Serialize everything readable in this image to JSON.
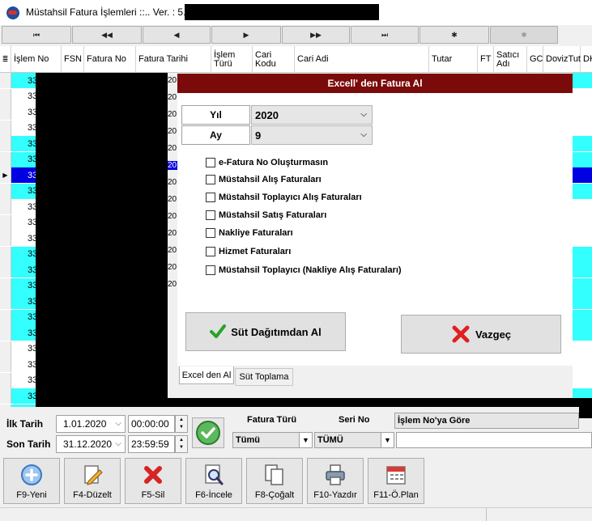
{
  "window": {
    "title": "Müstahsil Fatura İşlemleri ::.. Ver. : 5.0"
  },
  "nav": {
    "first": "⏮",
    "prev_page": "◀◀",
    "prev": "◀",
    "next": "▶",
    "next_page": "▶▶",
    "last": "⏭",
    "refresh": "✱",
    "cancel": "✱"
  },
  "grid": {
    "columns": [
      "İşlem No",
      "FSN",
      "Fatura No",
      "Fatura Tarihi",
      "İşlem Türü",
      "Cari Kodu",
      "Cari Adi",
      "Tutar",
      "FT",
      "Satıcı Adı",
      "GC",
      "DovizTut",
      "DK"
    ],
    "rows": [
      "33",
      "33",
      "33",
      "33",
      "33",
      "33",
      "33",
      "33",
      "33",
      "33",
      "33",
      "33",
      "33",
      "33",
      "33",
      "33",
      "33",
      "33",
      "33",
      "33",
      "33",
      "33"
    ],
    "fragments": [
      "20",
      "20",
      "20",
      "20",
      "20",
      "20",
      "20",
      "20",
      "20",
      "20",
      "20",
      "20",
      "20"
    ],
    "colors": {
      "cyan": "#33ffff",
      "selected": "#0000e0"
    }
  },
  "dialog": {
    "title": "Excell' den Fatura Al",
    "year_label": "Yıl",
    "year_value": "2020",
    "month_label": "Ay",
    "month_value": "9",
    "options": [
      "e-Fatura No Oluşturmasın",
      "Müstahsil Alış Faturaları",
      "Müstahsil Toplayıcı Alış Faturaları",
      "Müstahsil Satış Faturaları",
      "Nakliye Faturaları",
      "Hizmet Faturaları",
      "Müstahsil Toplayıcı (Nakliye Alış Faturaları)"
    ],
    "ok_button": "Süt Dağıtımdan Al",
    "cancel_button": "Vazgeç",
    "tabs": [
      "Excel den Al",
      "Süt Toplama"
    ],
    "title_color": "#7b0a0a"
  },
  "filters": {
    "start_label": "İlk Tarih",
    "start_date": "1.01.2020",
    "start_time": "00:00:00",
    "end_label": "Son Tarih",
    "end_date": "31.12.2020",
    "end_time": "23:59:59",
    "invoice_type_label": "Fatura Türü",
    "invoice_type_value": "Tümü",
    "series_label": "Seri No",
    "series_value": "TÜMÜ",
    "sort_value": "İşlem No'ya Göre"
  },
  "actions": [
    {
      "key": "F9-Yeni",
      "icon": "plus-icon"
    },
    {
      "key": "F4-Düzelt",
      "icon": "edit-icon"
    },
    {
      "key": "F5-Sil",
      "icon": "delete-icon"
    },
    {
      "key": "F6-İncele",
      "icon": "inspect-icon"
    },
    {
      "key": "F8-Çoğalt",
      "icon": "duplicate-icon"
    },
    {
      "key": "F10-Yazdır",
      "icon": "printer-icon"
    },
    {
      "key": "F11-Ö.Plan",
      "icon": "calendar-icon"
    }
  ]
}
